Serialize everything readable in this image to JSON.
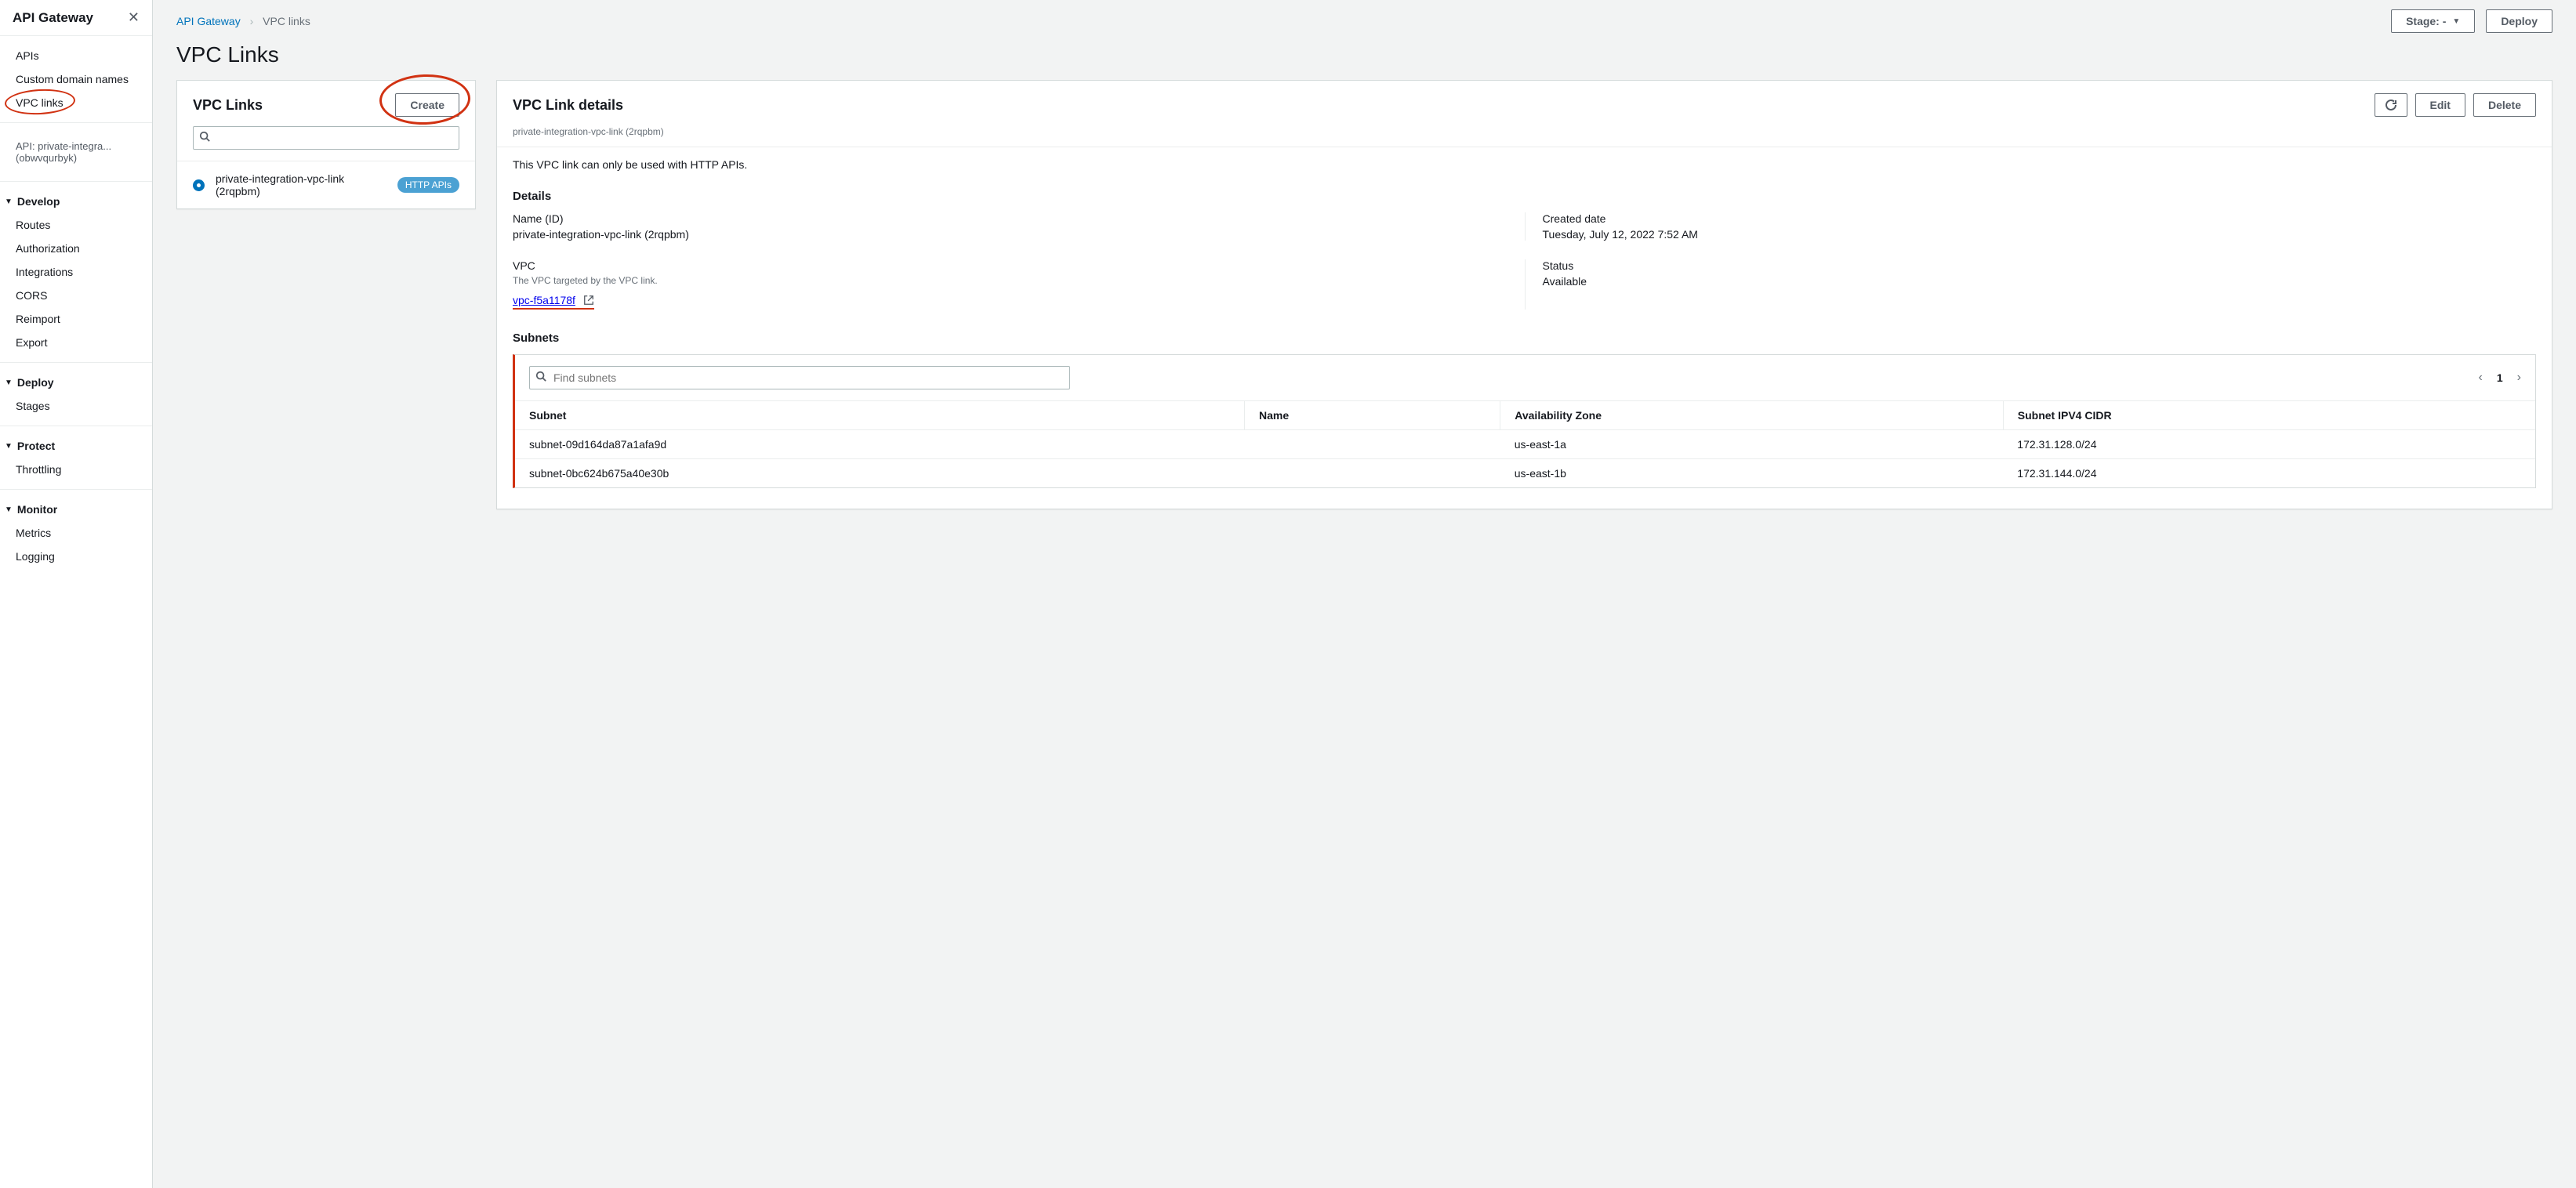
{
  "sidebar": {
    "title": "API Gateway",
    "top_items": [
      "APIs",
      "Custom domain names",
      "VPC links"
    ],
    "api_context": "API: private-integra... (obwvqurbyk)",
    "sections": [
      {
        "title": "Develop",
        "items": [
          "Routes",
          "Authorization",
          "Integrations",
          "CORS",
          "Reimport",
          "Export"
        ]
      },
      {
        "title": "Deploy",
        "items": [
          "Stages"
        ]
      },
      {
        "title": "Protect",
        "items": [
          "Throttling"
        ]
      },
      {
        "title": "Monitor",
        "items": [
          "Metrics",
          "Logging"
        ]
      }
    ]
  },
  "breadcrumb": {
    "root": "API Gateway",
    "current": "VPC links"
  },
  "topbar": {
    "stage_label": "Stage: -",
    "deploy_label": "Deploy"
  },
  "page_title": "VPC Links",
  "list_panel": {
    "title": "VPC Links",
    "create_label": "Create",
    "selected": {
      "name": "private-integration-vpc-link (2rqpbm)",
      "badge": "HTTP APIs"
    }
  },
  "details_panel": {
    "title": "VPC Link details",
    "subtitle": "private-integration-vpc-link (2rqpbm)",
    "edit_label": "Edit",
    "delete_label": "Delete",
    "notice": "This VPC link can only be used with HTTP APIs.",
    "section_details": "Details",
    "name_id_label": "Name (ID)",
    "name_id_value": "private-integration-vpc-link (2rqpbm)",
    "created_label": "Created date",
    "created_value": "Tuesday, July 12, 2022 7:52 AM",
    "vpc_label": "VPC",
    "vpc_help": "The VPC targeted by the VPC link.",
    "vpc_value": "vpc-f5a1178f",
    "status_label": "Status",
    "status_value": "Available"
  },
  "subnets": {
    "title": "Subnets",
    "search_placeholder": "Find subnets",
    "page": "1",
    "columns": [
      "Subnet",
      "Name",
      "Availability Zone",
      "Subnet IPV4 CIDR"
    ],
    "rows": [
      {
        "subnet": "subnet-09d164da87a1afa9d",
        "name": "",
        "az": "us-east-1a",
        "cidr": "172.31.128.0/24"
      },
      {
        "subnet": "subnet-0bc624b675a40e30b",
        "name": "",
        "az": "us-east-1b",
        "cidr": "172.31.144.0/24"
      }
    ]
  }
}
